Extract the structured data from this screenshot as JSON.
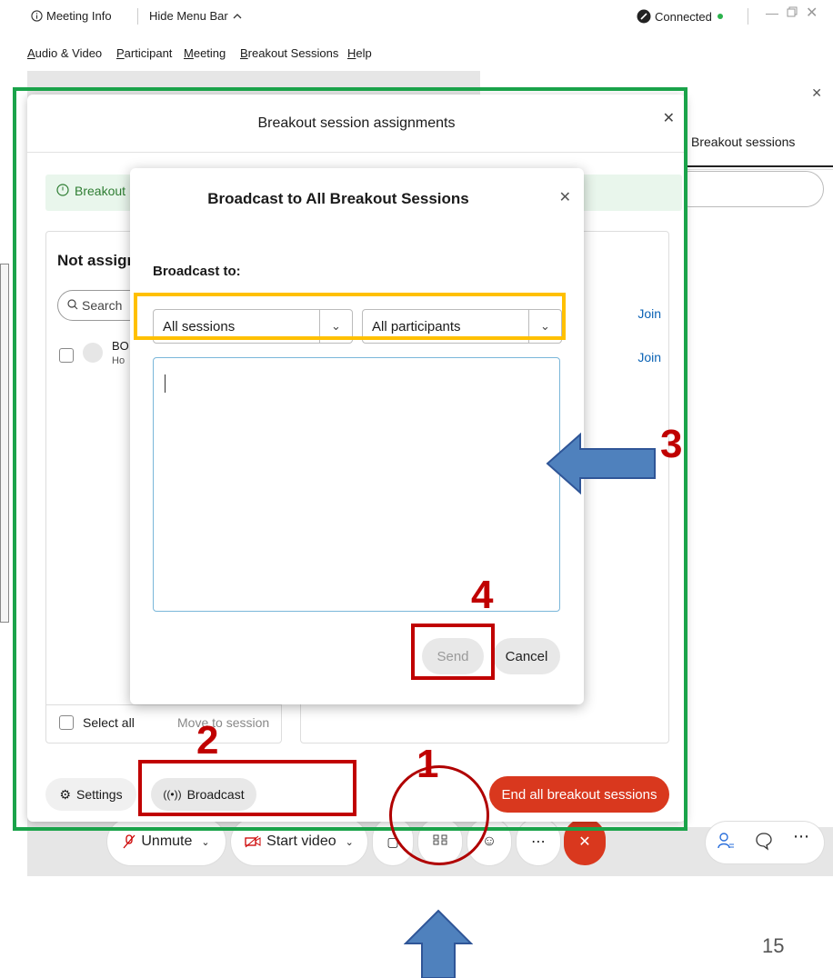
{
  "titlebar": {
    "meeting_info": "Meeting Info",
    "hide_menu_bar": "Hide Menu Bar",
    "connected": "Connected"
  },
  "menubar": {
    "items": [
      {
        "underline": "A",
        "rest": "udio & Video"
      },
      {
        "underline": "P",
        "rest": "articipant"
      },
      {
        "underline": "M",
        "rest": "eeting"
      },
      {
        "underline": "B",
        "rest": "reakout Sessions"
      },
      {
        "underline": "H",
        "rest": "elp"
      }
    ]
  },
  "right_panel": {
    "tab": "Breakout sessions"
  },
  "assignments": {
    "title": "Breakout session assignments",
    "banner": "Breakout",
    "not_assigned": "Not assign",
    "search_placeholder": "Search",
    "participant_initials": "BO",
    "participant_role": "Ho",
    "join_1": "Join",
    "join_2": "Join",
    "select_all": "Select all",
    "move_to_session": "Move to session",
    "settings": "Settings",
    "broadcast": "Broadcast",
    "end_all": "End all breakout sessions"
  },
  "dialog": {
    "title": "Broadcast to All Breakout Sessions",
    "broadcast_to": "Broadcast to:",
    "sessions_value": "All sessions",
    "participants_value": "All participants",
    "send": "Send",
    "cancel": "Cancel"
  },
  "toolbar": {
    "unmute": "Unmute",
    "start_video": "Start video"
  },
  "annotations": {
    "n1": "1",
    "n2": "2",
    "n3": "3",
    "n4": "4"
  },
  "slide_number": "15",
  "colors": {
    "green_outline": "#1aa34a",
    "annotation_red": "#c00000",
    "highlight_yellow": "#ffc000",
    "end_button": "#d9381e",
    "arrow_blue": "#4f81bd",
    "join_link": "#0b63b5"
  }
}
